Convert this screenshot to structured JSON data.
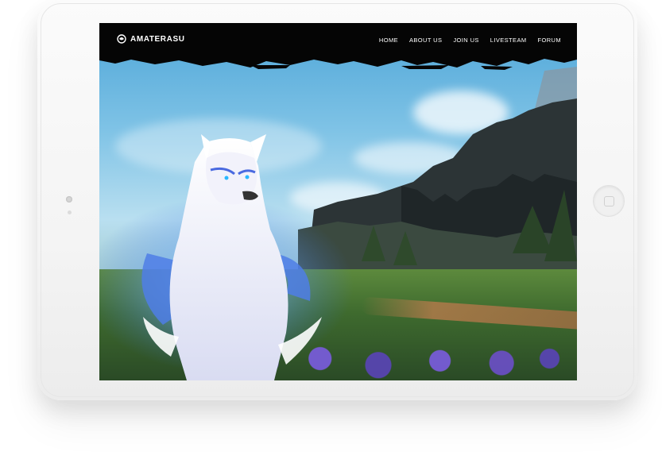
{
  "brand": {
    "name": "AMATERASU",
    "logo_icon": "dragon-emblem-icon"
  },
  "nav": {
    "items": [
      {
        "label": "HOME"
      },
      {
        "label": "ABOUT US"
      },
      {
        "label": "JOIN US"
      },
      {
        "label": "LIVESTEAM"
      },
      {
        "label": "FORUM"
      }
    ]
  },
  "hero": {
    "image": "white-wolf-fantasy-landscape"
  },
  "device": {
    "type": "tablet",
    "color": "#f4f4f4"
  },
  "colors": {
    "navbar": "#050505",
    "nav_text": "#ffffff"
  }
}
